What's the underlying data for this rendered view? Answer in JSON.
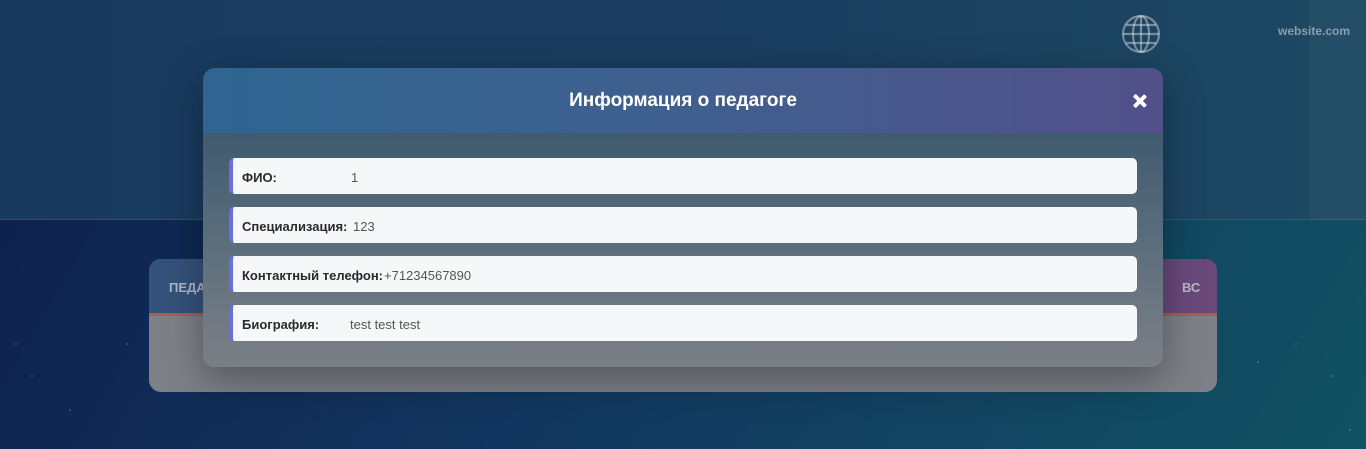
{
  "background": {
    "site_label": "website.com",
    "table_headers": [
      "ПЕДА",
      "ВС"
    ]
  },
  "modal": {
    "title": "Информация о педагоге",
    "close_label": "×",
    "fields": [
      {
        "label": "ФИО:",
        "value": "1"
      },
      {
        "label": "Специализация:",
        "value": "123"
      },
      {
        "label": "Контактный телефон:",
        "value": "+71234567890"
      },
      {
        "label": "Биография:",
        "value": "test test test"
      }
    ]
  },
  "colors": {
    "accent": "#6a6fe0",
    "row_background": "#f6f7f9"
  }
}
